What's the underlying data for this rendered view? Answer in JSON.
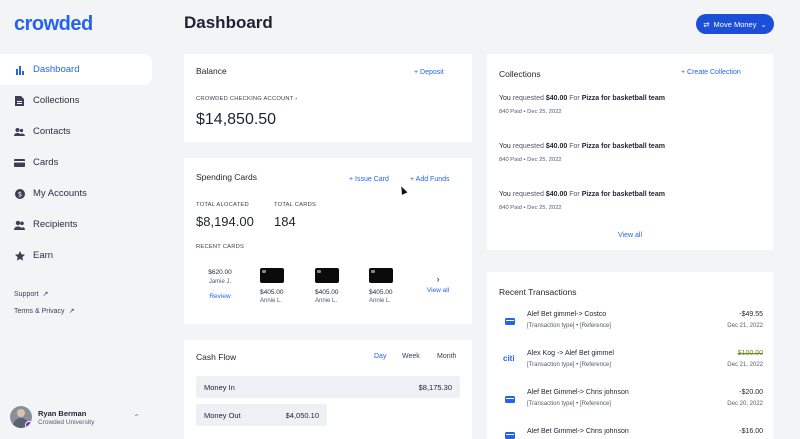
{
  "app": {
    "logo": "crowded",
    "page_title": "Dashboard"
  },
  "header": {
    "move_money": "Move Money"
  },
  "sidebar": {
    "items": [
      {
        "label": "Dashboard",
        "icon": "bar-chart-icon",
        "active": true
      },
      {
        "label": "Collections",
        "icon": "document-icon"
      },
      {
        "label": "Contacts",
        "icon": "people-icon"
      },
      {
        "label": "Cards",
        "icon": "card-icon"
      },
      {
        "label": "My Accounts",
        "icon": "dollar-icon"
      },
      {
        "label": "Recipients",
        "icon": "recipients-icon"
      },
      {
        "label": "Earn",
        "icon": "star-icon"
      }
    ],
    "support": "Support",
    "terms": "Terms & Privacy",
    "user": {
      "name": "Ryan Berman",
      "org": "Crowded University"
    }
  },
  "balance": {
    "title": "Balance",
    "deposit": "Deposit",
    "account_label": "CROWDED CHECKING ACCOUNT",
    "amount": "$14,850.50"
  },
  "spending": {
    "title": "Spending Cards",
    "issue_card": "+ Issue Card",
    "add_funds": "+ Add Funds",
    "total_allocated_label": "TOTAL ALOCATED",
    "total_allocated": "$8,194.00",
    "total_cards_label": "TOTAL CARDS",
    "total_cards": "184",
    "recent_label": "RECENT CARDS",
    "first_card": {
      "amount": "$620.00",
      "name": "Jamie J.",
      "action": "Review"
    },
    "cards": [
      {
        "amount": "$405.00",
        "name": "Annie L."
      },
      {
        "amount": "$405.00",
        "name": "Annie L."
      },
      {
        "amount": "$405.00",
        "name": "Annie L."
      }
    ],
    "view_all": "View all"
  },
  "cashflow": {
    "title": "Cash Flow",
    "tabs": [
      "Day",
      "Week",
      "Month"
    ],
    "money_in_label": "Money In",
    "money_in": "$8,175.30",
    "money_out_label": "Money Out",
    "money_out": "$4,050.10"
  },
  "collections": {
    "title": "Collections",
    "create": "Create Collection",
    "items": [
      {
        "prefix": "You",
        "mid": "requested",
        "amount": "$40.00",
        "for": "For",
        "item": "Pizza for basketball team",
        "paid": "840 Paid",
        "date": "Dec 25, 2022"
      },
      {
        "prefix": "You",
        "mid": "requested",
        "amount": "$40.00",
        "for": "For",
        "item": "Pizza for basketball team",
        "paid": "840 Paid",
        "date": "Dec 25, 2022"
      },
      {
        "prefix": "You",
        "mid": "requested",
        "amount": "$40.00",
        "for": "For",
        "item": "Pizza for basketball team",
        "paid": "840 Paid",
        "date": "Dec 25, 2022"
      }
    ],
    "view_all": "View all"
  },
  "transactions": {
    "title": "Recent Transactions",
    "items": [
      {
        "title": "Alef Bet gimmel-> Costco",
        "meta": "[Transaction type] • [Reference]",
        "amount": "-$49.55",
        "date": "Dec 21, 2022",
        "icon": "card-icon"
      },
      {
        "title": "Alex Kog -> Alef Bet gimmel",
        "meta": "[Transaction type] • [Reference]",
        "amount": "$100.00",
        "date": "Dec 21, 2022",
        "icon": "citi-logo",
        "logo_text": "citi",
        "amount_color": "#6b8e23"
      },
      {
        "title": "Alef Bet Gimmel-> Chris johnson",
        "meta": "[Transaction type] • [Reference]",
        "amount": "-$20.00",
        "date": "Dec 20, 2022",
        "icon": "card-icon"
      },
      {
        "title": "Alef Bet Gimmel-> Chris johnson",
        "meta": "",
        "amount": "-$16.00",
        "date": "",
        "icon": "card-icon"
      }
    ]
  },
  "colors": {
    "accent": "#2563eb",
    "button": "#1d4ed8",
    "positive": "#6b8e23"
  }
}
